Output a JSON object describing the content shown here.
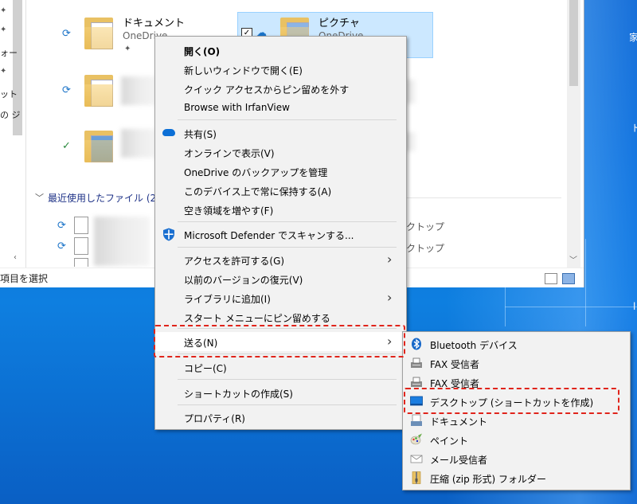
{
  "desktop": {
    "labels": [
      "家",
      "ド",
      "l"
    ]
  },
  "explorer": {
    "nav": {
      "items": [
        "ォー",
        "ット",
        "の ジ"
      ]
    },
    "tiles": [
      {
        "name": "ドキュメント",
        "sub": "OneDrive"
      },
      {
        "name": "ピクチャ",
        "sub": "OneDrive"
      }
    ],
    "section_header": "最近使用したファイル (20)",
    "right_texts": [
      "クトップ",
      "クトップ"
    ],
    "status": "項目を選択"
  },
  "context_menu": {
    "items": [
      {
        "label": "開く(O)",
        "bold": true
      },
      {
        "label": "新しいウィンドウで開く(E)"
      },
      {
        "label": "クイック アクセスからピン留めを外す"
      },
      {
        "label": "Browse with IrfanView"
      },
      {
        "label": "共有(S)",
        "icon": "onedrive-cloud-icon"
      },
      {
        "label": "オンラインで表示(V)"
      },
      {
        "label": "OneDrive のバックアップを管理"
      },
      {
        "label": "このデバイス上で常に保持する(A)"
      },
      {
        "label": "空き領域を増やす(F)"
      },
      {
        "label": "Microsoft Defender でスキャンする...",
        "icon": "defender-shield-icon"
      },
      {
        "label": "アクセスを許可する(G)",
        "submenu": true
      },
      {
        "label": "以前のバージョンの復元(V)"
      },
      {
        "label": "ライブラリに追加(I)",
        "submenu": true
      },
      {
        "label": "スタート メニューにピン留めする"
      },
      {
        "label": "送る(N)",
        "submenu": true
      },
      {
        "label": "コピー(C)"
      },
      {
        "label": "ショートカットの作成(S)"
      },
      {
        "label": "プロパティ(R)"
      }
    ]
  },
  "send_to_menu": {
    "items": [
      {
        "label": "Bluetooth デバイス",
        "icon": "bluetooth-icon"
      },
      {
        "label": "FAX 受信者",
        "icon": "fax-icon"
      },
      {
        "label": "FAX 受信者",
        "icon": "fax-icon"
      },
      {
        "label": "デスクトップ (ショートカットを作成)",
        "icon": "desktop-icon"
      },
      {
        "label": "ドキュメント",
        "icon": "documents-icon"
      },
      {
        "label": "ペイント",
        "icon": "paint-icon"
      },
      {
        "label": "メール受信者",
        "icon": "mail-icon"
      },
      {
        "label": "圧縮 (zip 形式) フォルダー",
        "icon": "zip-folder-icon"
      }
    ]
  },
  "colors": {
    "highlight": "#e0241b",
    "accent": "#0c6fd6",
    "selection": "#cce8ff"
  }
}
